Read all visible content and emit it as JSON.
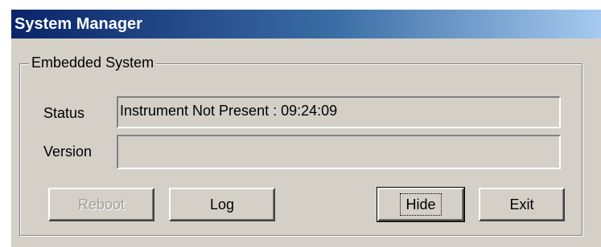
{
  "window": {
    "title": "System Manager"
  },
  "group": {
    "label": "Embedded System"
  },
  "fields": {
    "status_label": "Status",
    "status_value": "Instrument Not Present : 09:24:09",
    "version_label": "Version",
    "version_value": ""
  },
  "buttons": {
    "reboot": "Reboot",
    "log": "Log",
    "hide": "Hide",
    "exit": "Exit"
  },
  "states": {
    "reboot_disabled": true,
    "hide_focused": true
  }
}
